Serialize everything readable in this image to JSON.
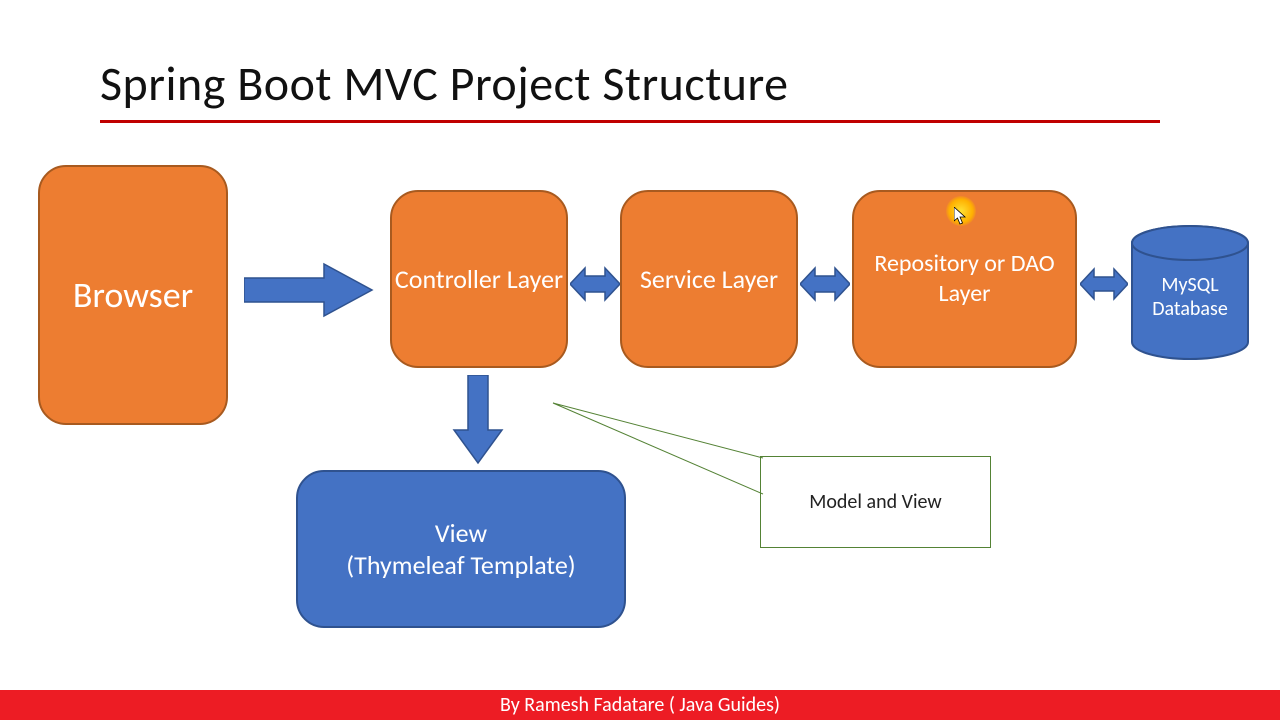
{
  "title": "Spring Boot MVC Project Structure",
  "nodes": {
    "browser": "Browser",
    "controller": "Controller Layer",
    "service": "Service Layer",
    "repository": "Repository or DAO Layer",
    "view": "View\n(Thymeleaf Template)",
    "database": "MySQL Database",
    "callout": "Model and View"
  },
  "footer": "By Ramesh Fadatare ( Java Guides)",
  "colors": {
    "orange": "#ed7d31",
    "blue": "#4472c4",
    "arrow_blue": "#4472c4",
    "callout_border": "#548235",
    "title_underline": "#c00000",
    "footer_red": "#ed1c24"
  },
  "edges": [
    {
      "from": "browser",
      "to": "controller",
      "type": "uni"
    },
    {
      "from": "controller",
      "to": "service",
      "type": "bi"
    },
    {
      "from": "service",
      "to": "repository",
      "type": "bi"
    },
    {
      "from": "repository",
      "to": "database",
      "type": "bi"
    },
    {
      "from": "controller",
      "to": "view",
      "type": "uni-down"
    },
    {
      "from": "callout",
      "to": "view",
      "type": "callout"
    }
  ]
}
